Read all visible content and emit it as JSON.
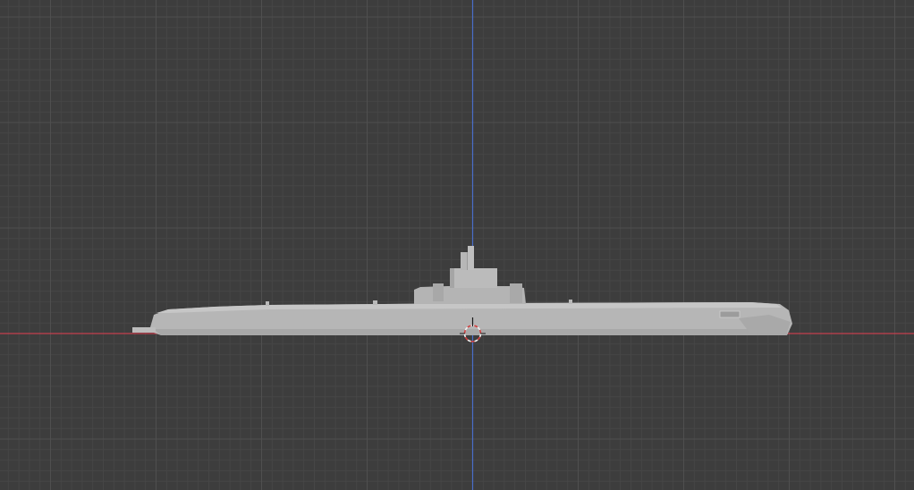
{
  "viewport": {
    "background_color": "#3d3d3d",
    "grid_minor_color": "#464646",
    "grid_major_color": "#4f4f4f",
    "x_axis_color": "#c4404e",
    "z_axis_color": "#4a6ec9",
    "model_color": "#b4b4b4",
    "model_shadow_color": "#9a9a9a",
    "model_highlight_color": "#c8c8c8",
    "cursor_ring_colors": [
      "#d24141",
      "#f0f0f0"
    ],
    "cursor_icon": "3d-cursor-icon"
  }
}
